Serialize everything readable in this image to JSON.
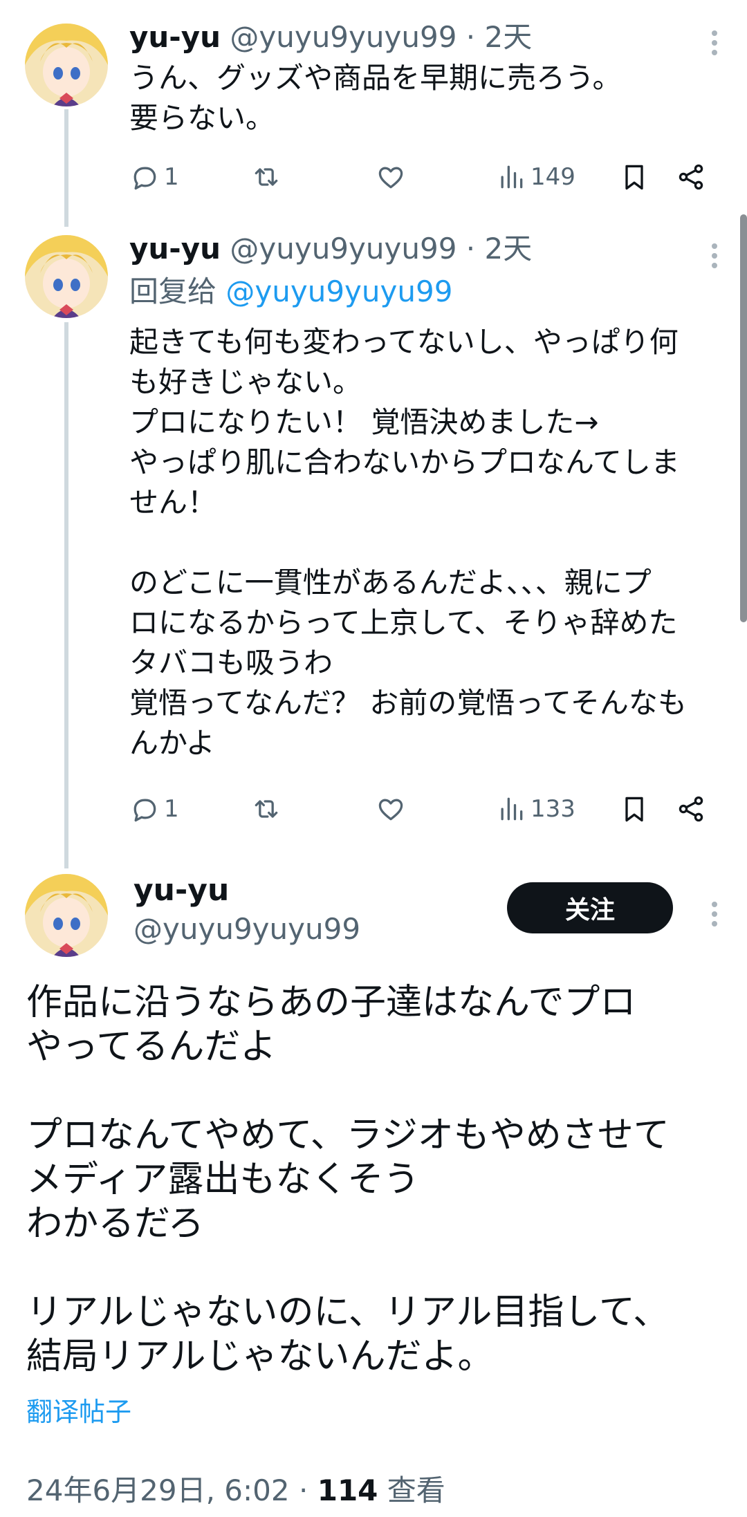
{
  "tweets": [
    {
      "name": "yu-yu",
      "handle": "@yuyu9yuyu99",
      "sep": "·",
      "time": "2天",
      "text": "うん、グッズや商品を早期に売ろう。\n要らない。",
      "replies": "1",
      "views": "149"
    },
    {
      "name": "yu-yu",
      "handle": "@yuyu9yuyu99",
      "sep": "·",
      "time": "2天",
      "reply_prefix": "回复给",
      "reply_handle": "@yuyu9yuyu99",
      "text": "起きても何も変わってないし、やっぱり何\nも好きじゃない。\nプロになりたい！ 覚悟決めました→\nやっぱり肌に合わないからプロなんてしま\nせん！\n\nのどこに一貫性があるんだよ、、、親にプ\nロになるからって上京して、そりゃ辞めた\nタバコも吸うわ\n覚悟ってなんだ？ お前の覚悟ってそんなも\nんかよ",
      "replies": "1",
      "views": "133"
    }
  ],
  "main": {
    "name": "yu-yu",
    "handle": "@yuyu9yuyu99",
    "follow_label": "关注",
    "text": "作品に沿うならあの子達はなんでプロ\nやってるんだよ\n\nプロなんてやめて、ラジオもやめさせて\nメディア露出もなくそう\nわかるだろ\n\nリアルじゃないのに、リアル目指して、\n結局リアルじゃないんだよ。",
    "translate_label": "翻译帖子",
    "timestamp": "24年6月29日, 6:02",
    "sep": "·",
    "views": "114",
    "views_label": "查看"
  },
  "icons": [
    "reply-icon",
    "retweet-icon",
    "like-icon",
    "views-icon",
    "bookmark-icon",
    "share-icon",
    "more-icon"
  ],
  "colors": {
    "text": "#0f1419",
    "muted": "#536471",
    "link": "#1d9bf0",
    "button": "#0f1419"
  }
}
